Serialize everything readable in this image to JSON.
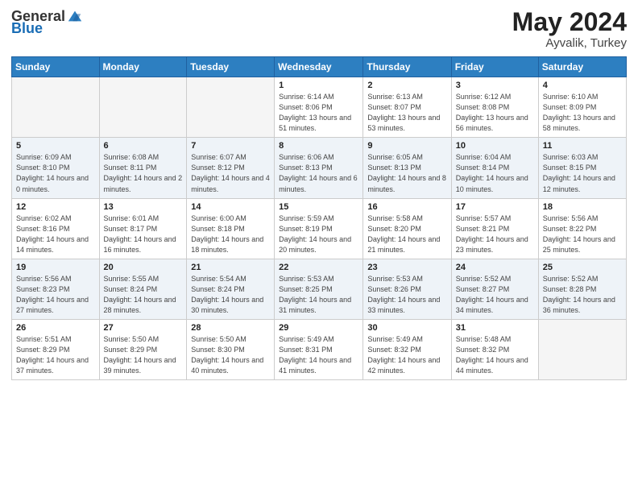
{
  "logo": {
    "general": "General",
    "blue": "Blue"
  },
  "title": {
    "month_year": "May 2024",
    "location": "Ayvalik, Turkey"
  },
  "weekdays": [
    "Sunday",
    "Monday",
    "Tuesday",
    "Wednesday",
    "Thursday",
    "Friday",
    "Saturday"
  ],
  "weeks": [
    [
      {
        "day": "",
        "sunrise": "",
        "sunset": "",
        "daylight": ""
      },
      {
        "day": "",
        "sunrise": "",
        "sunset": "",
        "daylight": ""
      },
      {
        "day": "",
        "sunrise": "",
        "sunset": "",
        "daylight": ""
      },
      {
        "day": "1",
        "sunrise": "Sunrise: 6:14 AM",
        "sunset": "Sunset: 8:06 PM",
        "daylight": "Daylight: 13 hours and 51 minutes."
      },
      {
        "day": "2",
        "sunrise": "Sunrise: 6:13 AM",
        "sunset": "Sunset: 8:07 PM",
        "daylight": "Daylight: 13 hours and 53 minutes."
      },
      {
        "day": "3",
        "sunrise": "Sunrise: 6:12 AM",
        "sunset": "Sunset: 8:08 PM",
        "daylight": "Daylight: 13 hours and 56 minutes."
      },
      {
        "day": "4",
        "sunrise": "Sunrise: 6:10 AM",
        "sunset": "Sunset: 8:09 PM",
        "daylight": "Daylight: 13 hours and 58 minutes."
      }
    ],
    [
      {
        "day": "5",
        "sunrise": "Sunrise: 6:09 AM",
        "sunset": "Sunset: 8:10 PM",
        "daylight": "Daylight: 14 hours and 0 minutes."
      },
      {
        "day": "6",
        "sunrise": "Sunrise: 6:08 AM",
        "sunset": "Sunset: 8:11 PM",
        "daylight": "Daylight: 14 hours and 2 minutes."
      },
      {
        "day": "7",
        "sunrise": "Sunrise: 6:07 AM",
        "sunset": "Sunset: 8:12 PM",
        "daylight": "Daylight: 14 hours and 4 minutes."
      },
      {
        "day": "8",
        "sunrise": "Sunrise: 6:06 AM",
        "sunset": "Sunset: 8:13 PM",
        "daylight": "Daylight: 14 hours and 6 minutes."
      },
      {
        "day": "9",
        "sunrise": "Sunrise: 6:05 AM",
        "sunset": "Sunset: 8:13 PM",
        "daylight": "Daylight: 14 hours and 8 minutes."
      },
      {
        "day": "10",
        "sunrise": "Sunrise: 6:04 AM",
        "sunset": "Sunset: 8:14 PM",
        "daylight": "Daylight: 14 hours and 10 minutes."
      },
      {
        "day": "11",
        "sunrise": "Sunrise: 6:03 AM",
        "sunset": "Sunset: 8:15 PM",
        "daylight": "Daylight: 14 hours and 12 minutes."
      }
    ],
    [
      {
        "day": "12",
        "sunrise": "Sunrise: 6:02 AM",
        "sunset": "Sunset: 8:16 PM",
        "daylight": "Daylight: 14 hours and 14 minutes."
      },
      {
        "day": "13",
        "sunrise": "Sunrise: 6:01 AM",
        "sunset": "Sunset: 8:17 PM",
        "daylight": "Daylight: 14 hours and 16 minutes."
      },
      {
        "day": "14",
        "sunrise": "Sunrise: 6:00 AM",
        "sunset": "Sunset: 8:18 PM",
        "daylight": "Daylight: 14 hours and 18 minutes."
      },
      {
        "day": "15",
        "sunrise": "Sunrise: 5:59 AM",
        "sunset": "Sunset: 8:19 PM",
        "daylight": "Daylight: 14 hours and 20 minutes."
      },
      {
        "day": "16",
        "sunrise": "Sunrise: 5:58 AM",
        "sunset": "Sunset: 8:20 PM",
        "daylight": "Daylight: 14 hours and 21 minutes."
      },
      {
        "day": "17",
        "sunrise": "Sunrise: 5:57 AM",
        "sunset": "Sunset: 8:21 PM",
        "daylight": "Daylight: 14 hours and 23 minutes."
      },
      {
        "day": "18",
        "sunrise": "Sunrise: 5:56 AM",
        "sunset": "Sunset: 8:22 PM",
        "daylight": "Daylight: 14 hours and 25 minutes."
      }
    ],
    [
      {
        "day": "19",
        "sunrise": "Sunrise: 5:56 AM",
        "sunset": "Sunset: 8:23 PM",
        "daylight": "Daylight: 14 hours and 27 minutes."
      },
      {
        "day": "20",
        "sunrise": "Sunrise: 5:55 AM",
        "sunset": "Sunset: 8:24 PM",
        "daylight": "Daylight: 14 hours and 28 minutes."
      },
      {
        "day": "21",
        "sunrise": "Sunrise: 5:54 AM",
        "sunset": "Sunset: 8:24 PM",
        "daylight": "Daylight: 14 hours and 30 minutes."
      },
      {
        "day": "22",
        "sunrise": "Sunrise: 5:53 AM",
        "sunset": "Sunset: 8:25 PM",
        "daylight": "Daylight: 14 hours and 31 minutes."
      },
      {
        "day": "23",
        "sunrise": "Sunrise: 5:53 AM",
        "sunset": "Sunset: 8:26 PM",
        "daylight": "Daylight: 14 hours and 33 minutes."
      },
      {
        "day": "24",
        "sunrise": "Sunrise: 5:52 AM",
        "sunset": "Sunset: 8:27 PM",
        "daylight": "Daylight: 14 hours and 34 minutes."
      },
      {
        "day": "25",
        "sunrise": "Sunrise: 5:52 AM",
        "sunset": "Sunset: 8:28 PM",
        "daylight": "Daylight: 14 hours and 36 minutes."
      }
    ],
    [
      {
        "day": "26",
        "sunrise": "Sunrise: 5:51 AM",
        "sunset": "Sunset: 8:29 PM",
        "daylight": "Daylight: 14 hours and 37 minutes."
      },
      {
        "day": "27",
        "sunrise": "Sunrise: 5:50 AM",
        "sunset": "Sunset: 8:29 PM",
        "daylight": "Daylight: 14 hours and 39 minutes."
      },
      {
        "day": "28",
        "sunrise": "Sunrise: 5:50 AM",
        "sunset": "Sunset: 8:30 PM",
        "daylight": "Daylight: 14 hours and 40 minutes."
      },
      {
        "day": "29",
        "sunrise": "Sunrise: 5:49 AM",
        "sunset": "Sunset: 8:31 PM",
        "daylight": "Daylight: 14 hours and 41 minutes."
      },
      {
        "day": "30",
        "sunrise": "Sunrise: 5:49 AM",
        "sunset": "Sunset: 8:32 PM",
        "daylight": "Daylight: 14 hours and 42 minutes."
      },
      {
        "day": "31",
        "sunrise": "Sunrise: 5:48 AM",
        "sunset": "Sunset: 8:32 PM",
        "daylight": "Daylight: 14 hours and 44 minutes."
      },
      {
        "day": "",
        "sunrise": "",
        "sunset": "",
        "daylight": ""
      }
    ]
  ]
}
